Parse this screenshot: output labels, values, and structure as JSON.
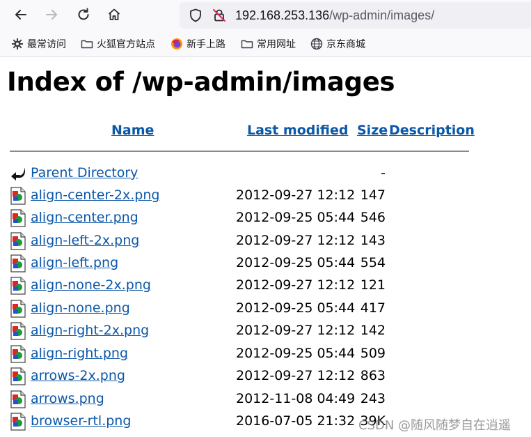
{
  "browser": {
    "url_host": "192.168.253.136",
    "url_path": "/wp-admin/images/"
  },
  "bookmarks": [
    {
      "label": "最常访问",
      "icon": "gear-icon"
    },
    {
      "label": "火狐官方站点",
      "icon": "folder-icon"
    },
    {
      "label": "新手上路",
      "icon": "firefox-icon"
    },
    {
      "label": "常用网址",
      "icon": "folder-icon"
    },
    {
      "label": "京东商城",
      "icon": "globe-icon"
    }
  ],
  "page": {
    "title": "Index of /wp-admin/images"
  },
  "table": {
    "headers": {
      "name": "Name",
      "last_modified": "Last modified",
      "size": "Size",
      "description": "Description"
    },
    "rows": [
      {
        "name": "Parent Directory",
        "modified": "",
        "size": "-",
        "icon": "back-arrow-icon"
      },
      {
        "name": "align-center-2x.png",
        "modified": "2012-09-27 12:12",
        "size": "147",
        "icon": "image-file-icon"
      },
      {
        "name": "align-center.png",
        "modified": "2012-09-25 05:44",
        "size": "546",
        "icon": "image-file-icon"
      },
      {
        "name": "align-left-2x.png",
        "modified": "2012-09-27 12:12",
        "size": "143",
        "icon": "image-file-icon"
      },
      {
        "name": "align-left.png",
        "modified": "2012-09-25 05:44",
        "size": "554",
        "icon": "image-file-icon"
      },
      {
        "name": "align-none-2x.png",
        "modified": "2012-09-27 12:12",
        "size": "121",
        "icon": "image-file-icon"
      },
      {
        "name": "align-none.png",
        "modified": "2012-09-25 05:44",
        "size": "417",
        "icon": "image-file-icon"
      },
      {
        "name": "align-right-2x.png",
        "modified": "2012-09-27 12:12",
        "size": "142",
        "icon": "image-file-icon"
      },
      {
        "name": "align-right.png",
        "modified": "2012-09-25 05:44",
        "size": "509",
        "icon": "image-file-icon"
      },
      {
        "name": "arrows-2x.png",
        "modified": "2012-09-27 12:12",
        "size": "863",
        "icon": "image-file-icon"
      },
      {
        "name": "arrows.png",
        "modified": "2012-11-08 04:49",
        "size": "243",
        "icon": "image-file-icon"
      },
      {
        "name": "browser-rtl.png",
        "modified": "2016-07-05 21:32",
        "size": "39K",
        "icon": "image-file-icon"
      }
    ]
  },
  "watermark": "CSDN @随风随梦自在逍遥"
}
